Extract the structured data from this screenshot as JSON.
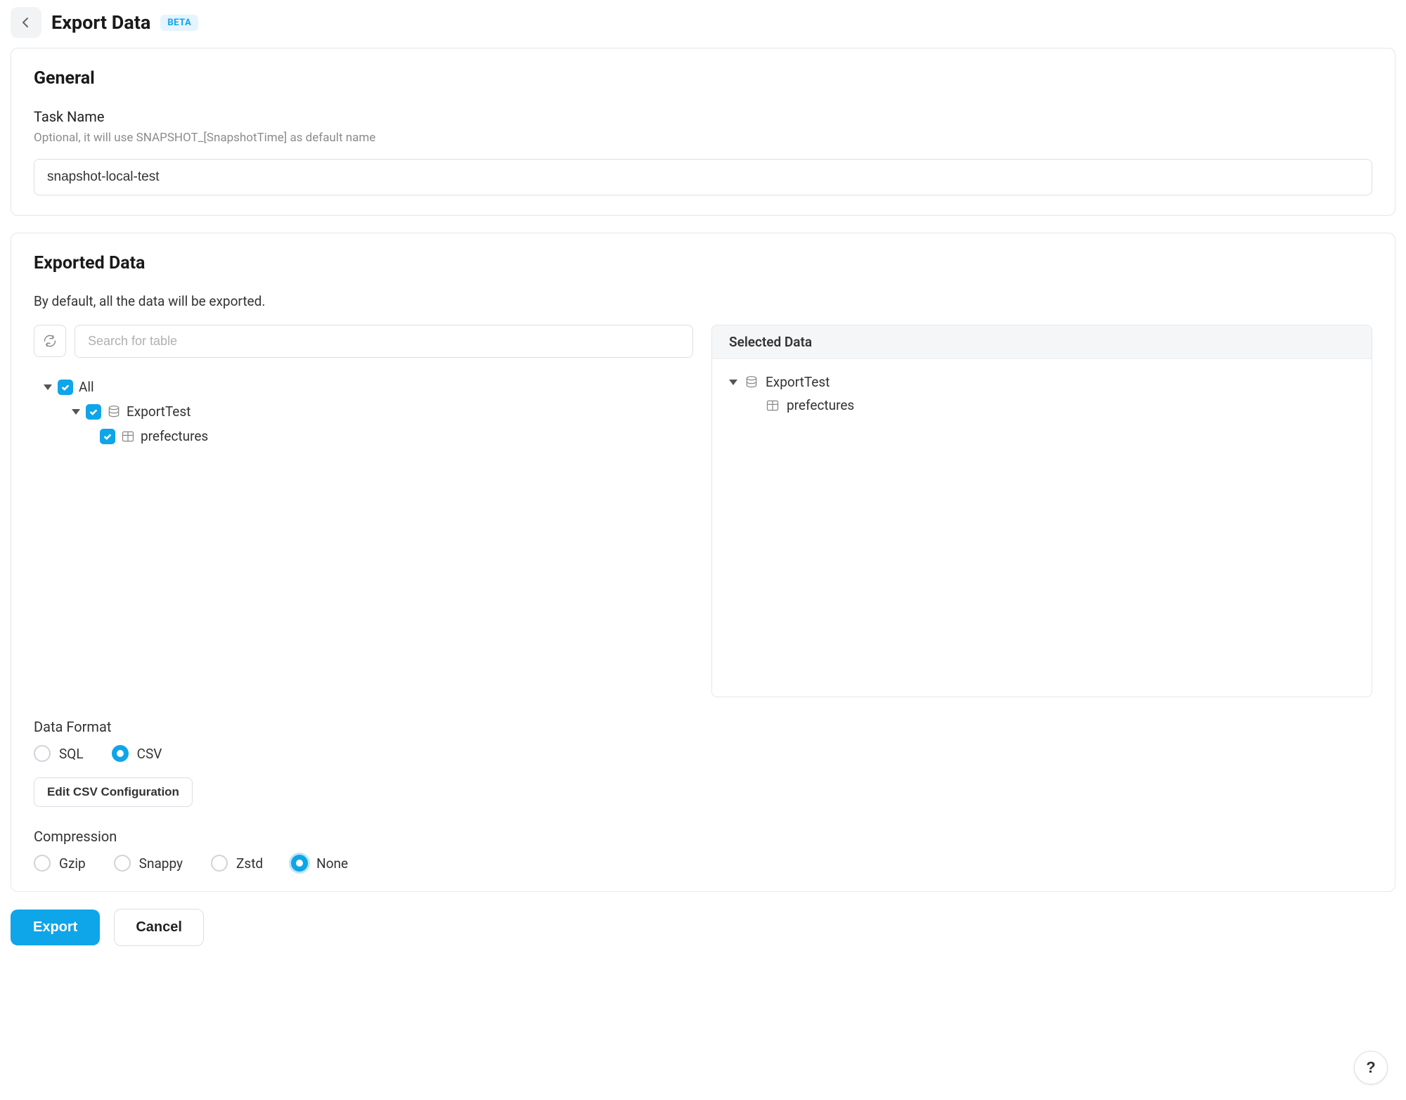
{
  "header": {
    "title": "Export Data",
    "badge": "BETA"
  },
  "general": {
    "title": "General",
    "task_name_label": "Task Name",
    "task_name_helper": "Optional, it will use SNAPSHOT_[SnapshotTime] as default name",
    "task_name_value": "snapshot-local-test"
  },
  "exported": {
    "title": "Exported Data",
    "description": "By default, all the data will be exported.",
    "search_placeholder": "Search for table",
    "tree": {
      "root_label": "All",
      "db_label": "ExportTest",
      "table_label": "prefectures"
    },
    "selected_header": "Selected Data",
    "selected": {
      "db_label": "ExportTest",
      "table_label": "prefectures"
    }
  },
  "format": {
    "label": "Data Format",
    "options": {
      "sql": "SQL",
      "csv": "CSV"
    },
    "selected": "csv",
    "edit_csv_label": "Edit CSV Configuration"
  },
  "compression": {
    "label": "Compression",
    "options": {
      "gzip": "Gzip",
      "snappy": "Snappy",
      "zstd": "Zstd",
      "none": "None"
    },
    "selected": "none"
  },
  "footer": {
    "export": "Export",
    "cancel": "Cancel"
  },
  "help": "?"
}
